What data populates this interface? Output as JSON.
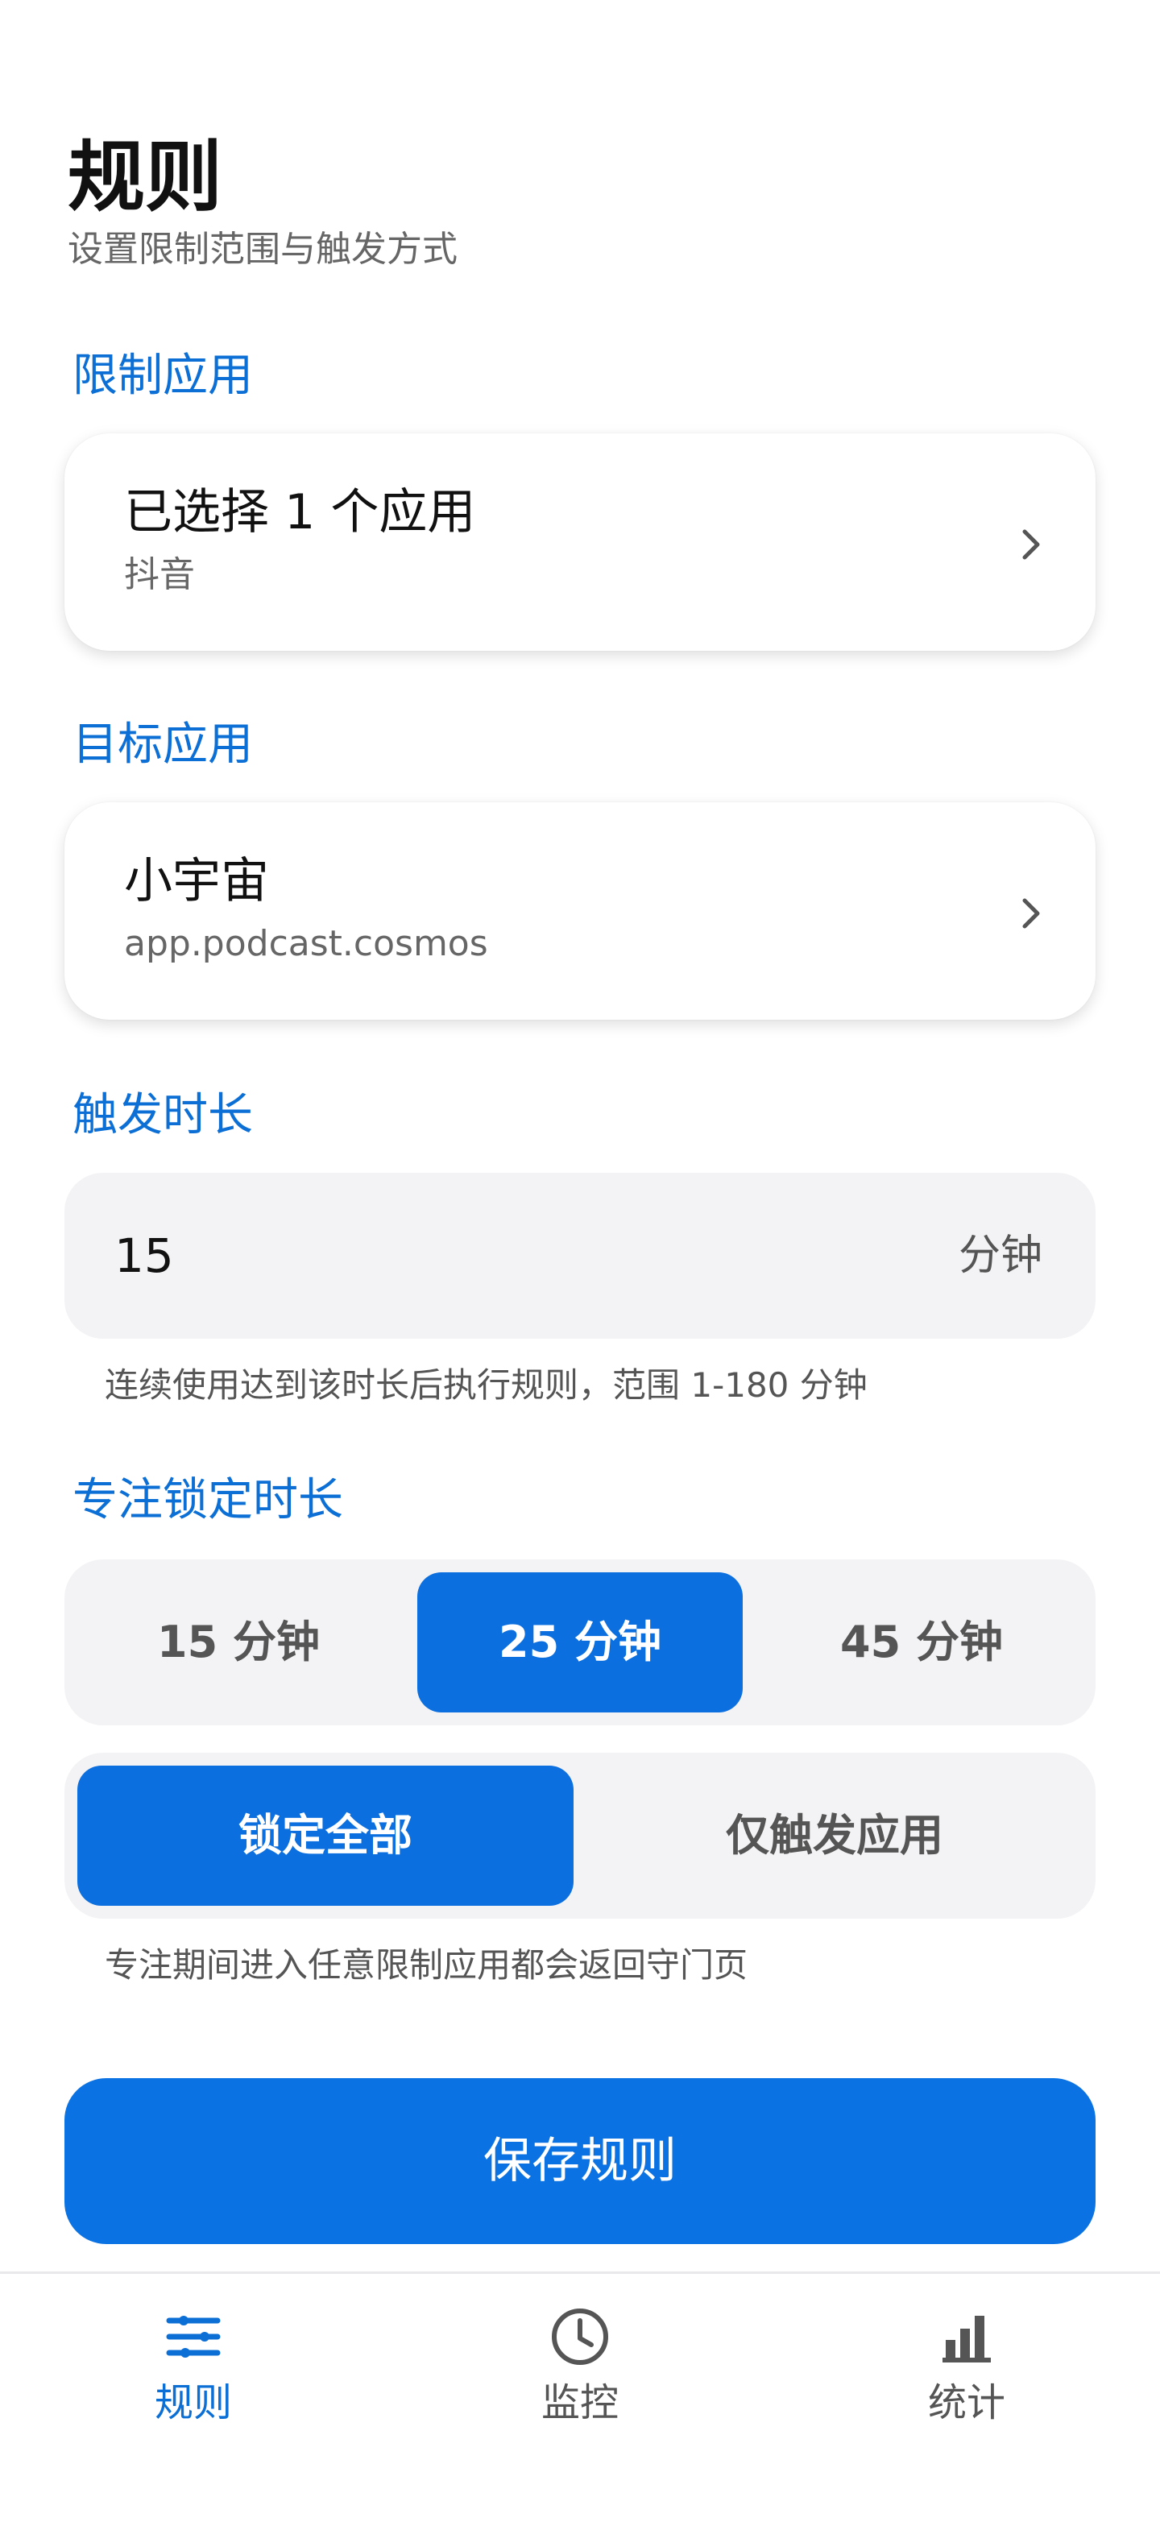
{
  "header": {
    "title": "规则",
    "subtitle": "设置限制范围与触发方式"
  },
  "restricted_apps": {
    "section_label": "限制应用",
    "title": "已选择 1 个应用",
    "subtitle": "抖音"
  },
  "target_app": {
    "section_label": "目标应用",
    "title": "小宇宙",
    "subtitle": "app.podcast.cosmos"
  },
  "trigger_duration": {
    "section_label": "触发时长",
    "value": "15",
    "unit": "分钟",
    "hint": "连续使用达到该时长后执行规则，范围 1-180 分钟"
  },
  "focus_lock": {
    "section_label": "专注锁定时长",
    "duration_options": [
      "15 分钟",
      "25 分钟",
      "45 分钟"
    ],
    "selected_duration": "25 分钟",
    "scope_options": [
      "锁定全部",
      "仅触发应用"
    ],
    "selected_scope": "锁定全部",
    "hint": "专注期间进入任意限制应用都会返回守门页"
  },
  "save_button": {
    "label": "保存规则"
  },
  "bottom_nav": {
    "items": [
      {
        "label": "规则",
        "icon": "sliders-icon",
        "active": true
      },
      {
        "label": "监控",
        "icon": "clock-icon",
        "active": false
      },
      {
        "label": "统计",
        "icon": "bar-chart-icon",
        "active": false
      }
    ]
  },
  "colors": {
    "accent": "#0b6fe0",
    "section_label": "#0b6fd6",
    "surface": "#f3f3f5"
  }
}
